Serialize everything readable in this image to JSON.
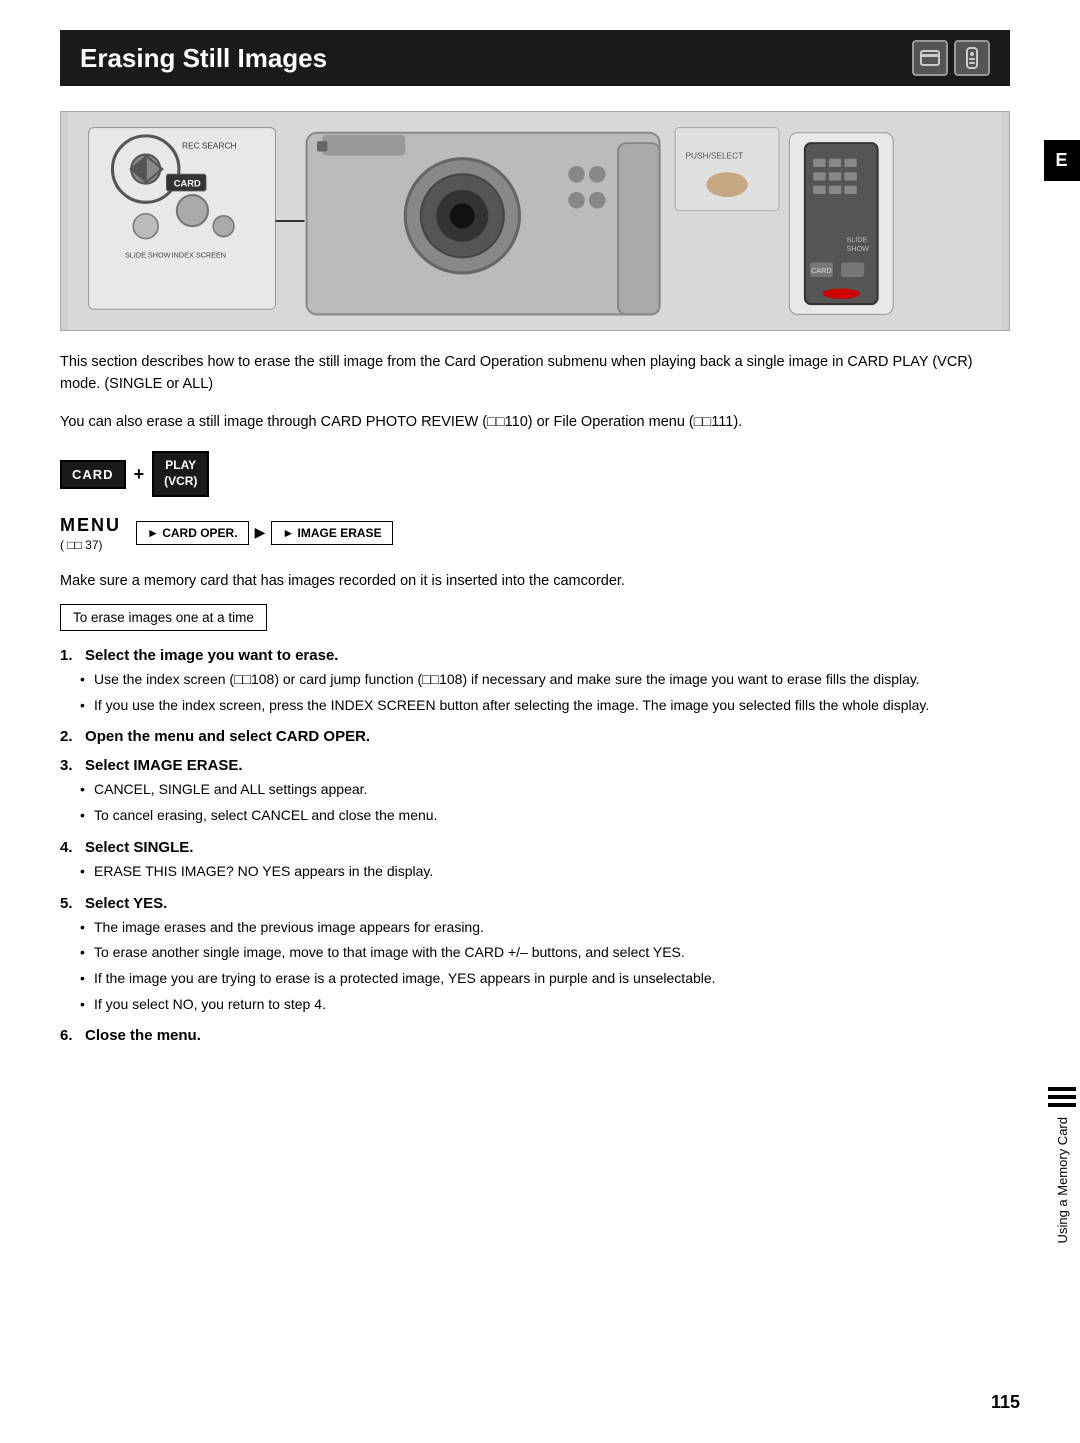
{
  "page": {
    "title": "Erasing Still Images",
    "page_number": "115",
    "tab_letter": "E",
    "vertical_tab_text": "Using a Memory Card"
  },
  "hero": {
    "alt": "Camera diagram showing card operation controls and remote"
  },
  "intro": {
    "para1": "This section describes how to erase the still image from the Card Operation submenu when playing back a single image in CARD PLAY (VCR) mode. (SINGLE or ALL)",
    "para2": "You can also erase a still image through CARD PHOTO REVIEW (□□110) or File Operation menu (□□111)."
  },
  "button_combo": {
    "card_label": "CARD",
    "plus": "+",
    "play_line1": "PLAY",
    "play_line2": "(VCR)"
  },
  "menu_section": {
    "label": "MENU",
    "ref": "( □□ 37)",
    "arrow1": "► CARD OPER.",
    "arrow2": "► IMAGE ERASE"
  },
  "instruction": "Make sure a memory card that has images recorded on it is inserted into the camcorder.",
  "bordered_note": "To erase images one at a time",
  "steps": [
    {
      "num": "1.",
      "title": "Select the image you want to erase.",
      "bullets": [
        "Use the index screen (□□108) or card jump function (□□108) if necessary and make sure the image you want to erase fills the display.",
        "If you use the index screen, press the INDEX SCREEN button after selecting the image. The image you selected fills the whole display."
      ]
    },
    {
      "num": "2.",
      "title": "Open the menu and select CARD OPER.",
      "bullets": []
    },
    {
      "num": "3.",
      "title": "Select IMAGE ERASE.",
      "bullets": [
        "CANCEL, SINGLE and ALL settings appear.",
        "To cancel erasing, select CANCEL and close the menu."
      ]
    },
    {
      "num": "4.",
      "title": "Select SINGLE.",
      "bullets": [
        "ERASE THIS IMAGE? NO YES appears in the display."
      ]
    },
    {
      "num": "5.",
      "title": "Select YES.",
      "bullets": [
        "The image erases and the previous image appears for erasing.",
        "To erase another single image, move to that image with the CARD +/– buttons, and select YES.",
        "If the image you are trying to erase is a protected image, YES appears in purple and is unselectable.",
        "If you select NO, you return to step 4."
      ]
    },
    {
      "num": "6.",
      "title": "Close the menu.",
      "bullets": []
    }
  ]
}
